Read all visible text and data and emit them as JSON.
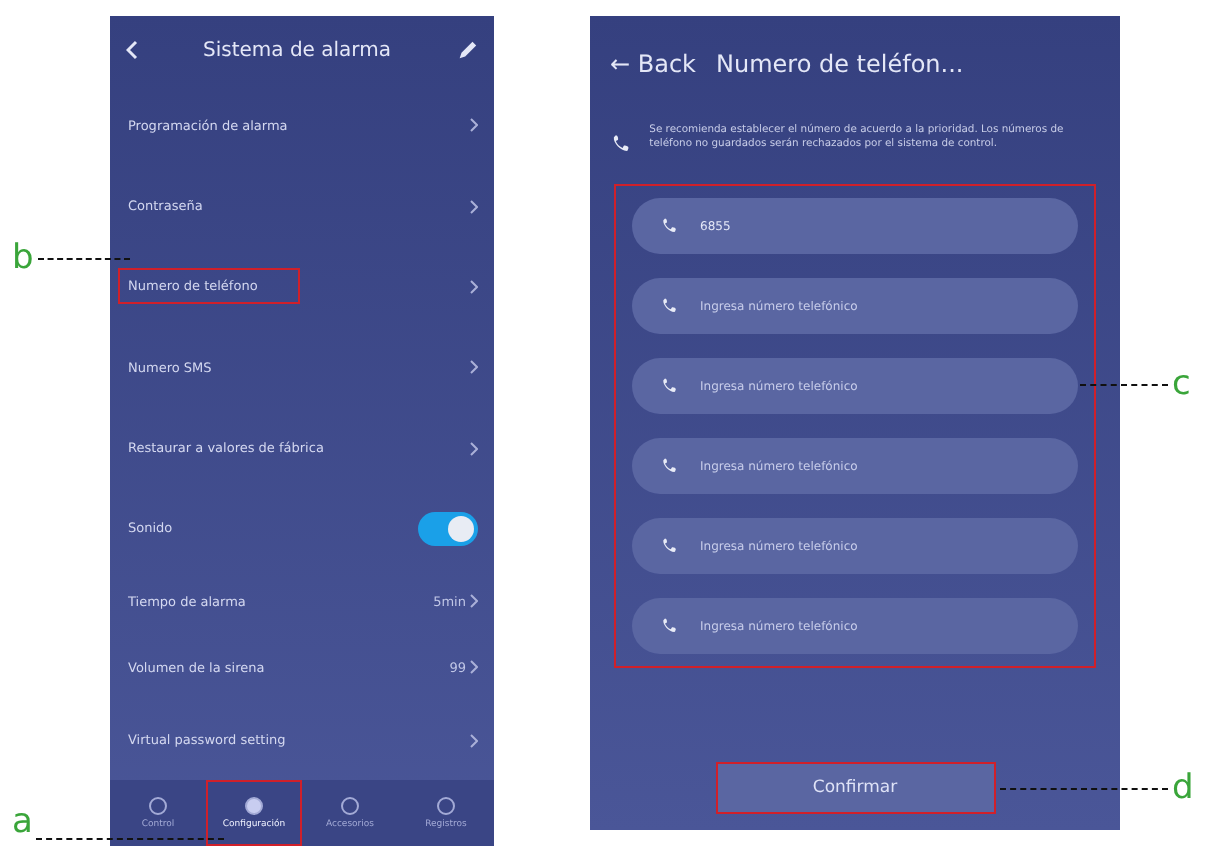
{
  "settings_screen": {
    "title": "Sistema de alarma",
    "items": [
      {
        "kind": "link",
        "label": "Programación de alarma",
        "highlighted": false
      },
      {
        "kind": "link",
        "label": "Contraseña",
        "highlighted": false
      },
      {
        "kind": "link",
        "label": "Numero de teléfono",
        "highlighted": true
      },
      {
        "kind": "link",
        "label": "Numero SMS",
        "highlighted": false
      },
      {
        "kind": "link",
        "label": "Restaurar a valores de fábrica",
        "highlighted": false
      },
      {
        "kind": "toggle",
        "label": "Sonido",
        "on": true,
        "highlighted": false
      },
      {
        "kind": "value",
        "label": "Tiempo de alarma",
        "value": "5min",
        "highlighted": false
      },
      {
        "kind": "value",
        "label": "Volumen de la sirena",
        "value": "99",
        "highlighted": false
      },
      {
        "kind": "link",
        "label": "Virtual password setting",
        "highlighted": false
      }
    ],
    "tabs": [
      {
        "label": "Control",
        "selected": false,
        "highlighted": false
      },
      {
        "label": "Configuración",
        "selected": true,
        "highlighted": true
      },
      {
        "label": "Accesorios",
        "selected": false,
        "highlighted": false
      },
      {
        "label": "Registros",
        "selected": false,
        "highlighted": false
      }
    ]
  },
  "phone_screen": {
    "back": "← Back",
    "title": "Numero de teléfon...",
    "notice": "Se recomienda establecer el número de acuerdo a la prioridad. Los números de teléfono no guardados serán rechazados por el sistema de control.",
    "fields": [
      {
        "value": "6855"
      },
      {
        "placeholder": "Ingresa número telefónico"
      },
      {
        "placeholder": "Ingresa número telefónico"
      },
      {
        "placeholder": "Ingresa número telefónico"
      },
      {
        "placeholder": "Ingresa número telefónico"
      },
      {
        "placeholder": "Ingresa número telefónico"
      }
    ],
    "confirm": "Confirmar"
  },
  "callouts": [
    {
      "letter": "b"
    },
    {
      "letter": "a"
    },
    {
      "letter": "c"
    },
    {
      "letter": "d"
    }
  ]
}
